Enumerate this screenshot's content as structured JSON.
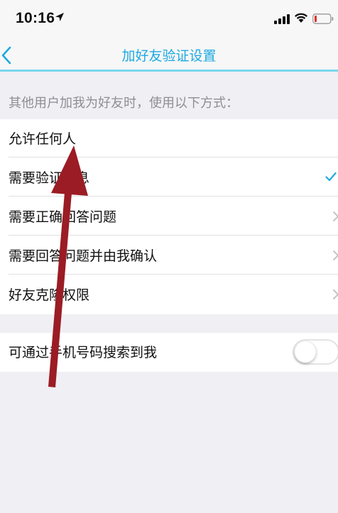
{
  "status_bar": {
    "time": "10:16",
    "icons": [
      "location-arrow-icon",
      "cellular-signal-icon",
      "wifi-icon",
      "battery-icon"
    ]
  },
  "nav": {
    "title": "加好友验证设置",
    "back_icon": "chevron-left-icon",
    "accent_color": "#1ea9e1"
  },
  "section_header": "其他用户加我为好友时，使用以下方式：",
  "options": [
    {
      "label": "允许任何人",
      "accessory": ""
    },
    {
      "label": "需要验证信息",
      "accessory": "checkmark-icon",
      "selected": true
    },
    {
      "label": "需要正确回答问题",
      "accessory": "chevron-right-icon"
    },
    {
      "label": "需要回答问题并由我确认",
      "accessory": "chevron-right-icon"
    },
    {
      "label": "好友克隆权限",
      "accessory": "chevron-right-icon"
    }
  ],
  "phone_search": {
    "label": "可通过手机号码搜索到我",
    "enabled": false
  },
  "annotation": {
    "icon": "red-arrow-annotation",
    "color": "#9b1c24"
  }
}
